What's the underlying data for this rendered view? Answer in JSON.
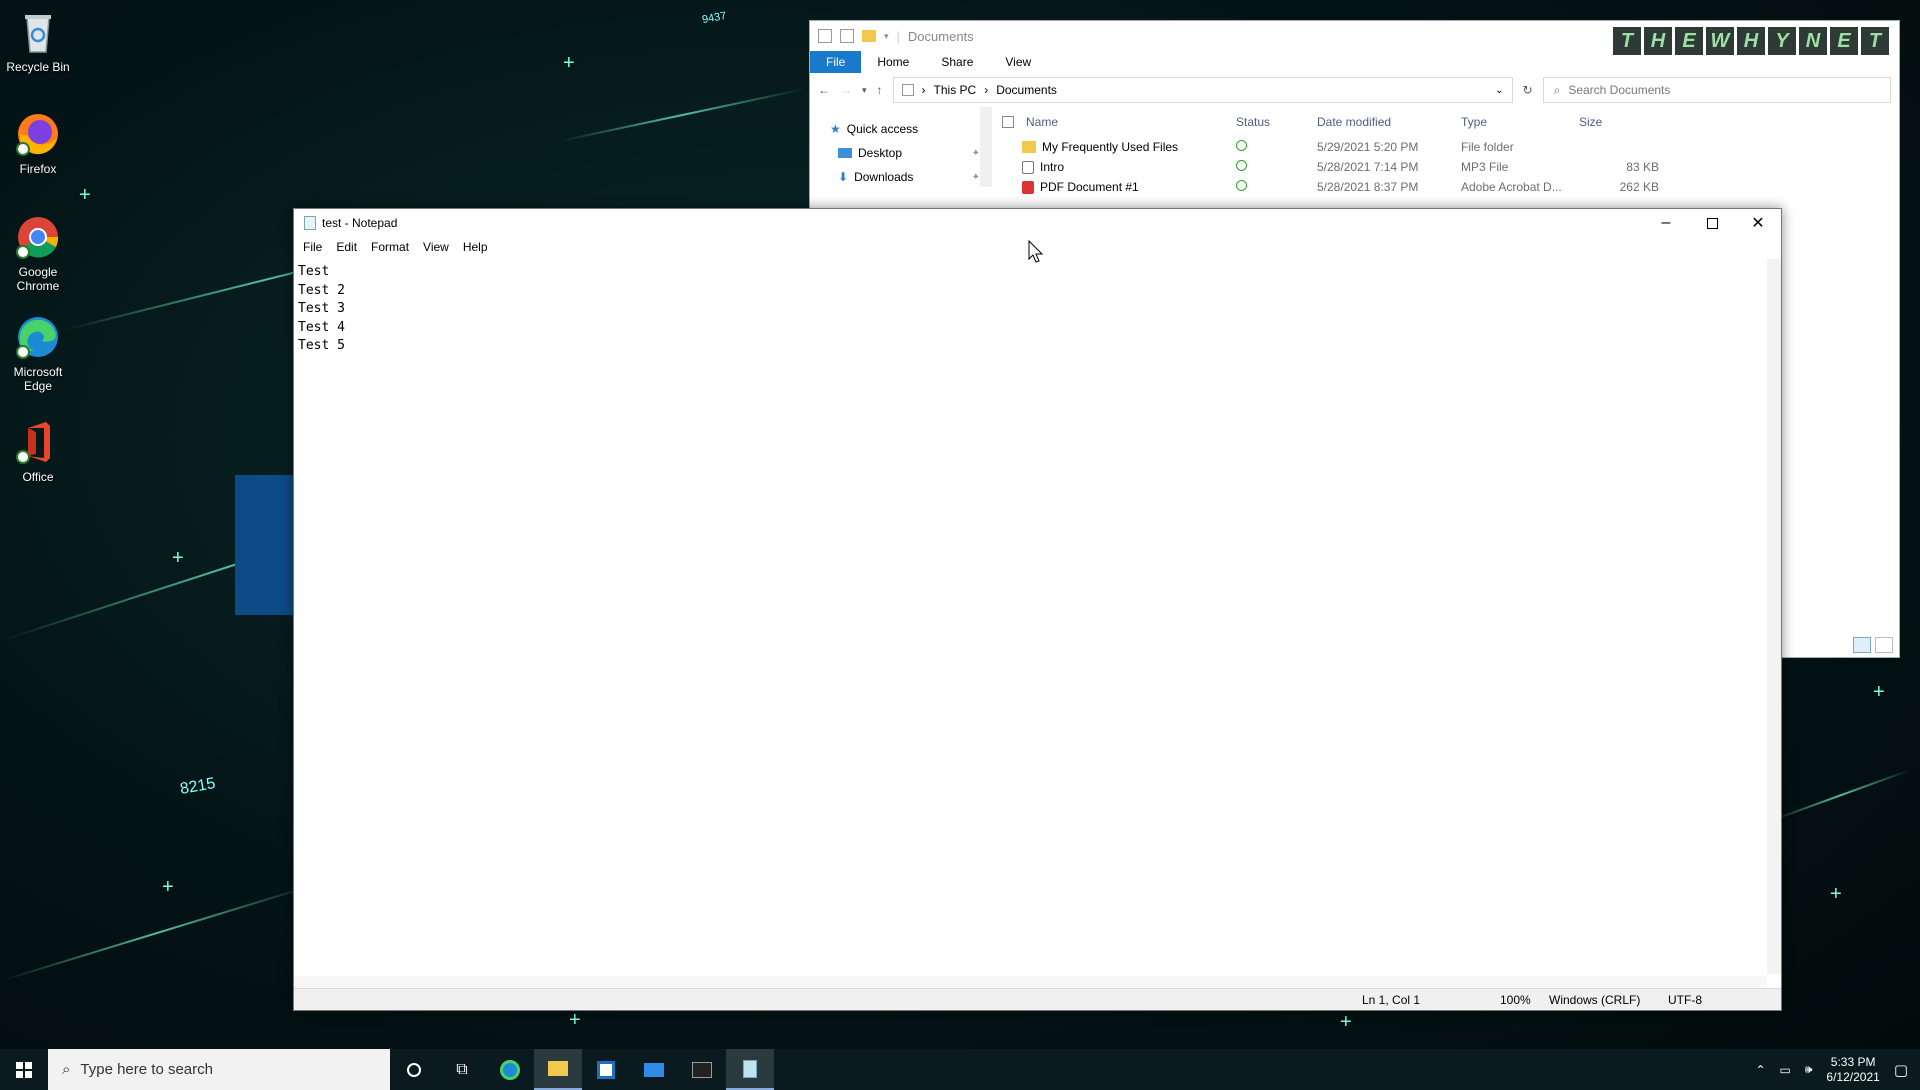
{
  "desktop": {
    "icons": [
      {
        "label": "Recycle Bin"
      },
      {
        "label": "Firefox"
      },
      {
        "label": "Google Chrome"
      },
      {
        "label": "Microsoft Edge"
      },
      {
        "label": "Office"
      }
    ],
    "deco_numbers": [
      "9437",
      "8215"
    ]
  },
  "explorer": {
    "title": "Documents",
    "ribbon": {
      "file": "File",
      "home": "Home",
      "share": "Share",
      "view": "View"
    },
    "breadcrumb": {
      "root": "This PC",
      "current": "Documents"
    },
    "search_placeholder": "Search Documents",
    "nav": {
      "quick_access": "Quick access",
      "desktop": "Desktop",
      "downloads": "Downloads"
    },
    "columns": {
      "name": "Name",
      "status": "Status",
      "date": "Date modified",
      "type": "Type",
      "size": "Size"
    },
    "files": [
      {
        "name": "My Frequently Used Files",
        "date": "5/29/2021 5:20 PM",
        "type": "File folder",
        "size": ""
      },
      {
        "name": "Intro",
        "date": "5/28/2021 7:14 PM",
        "type": "MP3 File",
        "size": "83 KB"
      },
      {
        "name": "PDF Document #1",
        "date": "5/28/2021 8:37 PM",
        "type": "Adobe Acrobat D...",
        "size": "262 KB"
      }
    ],
    "brand_letters": [
      "T",
      "H",
      "E",
      "W",
      "H",
      "Y",
      "N",
      "E",
      "T"
    ]
  },
  "notepad": {
    "title": "test - Notepad",
    "menu": {
      "file": "File",
      "edit": "Edit",
      "format": "Format",
      "view": "View",
      "help": "Help"
    },
    "content": "Test\nTest 2\nTest 3\nTest 4\nTest 5",
    "status": {
      "position": "Ln 1, Col 1",
      "zoom": "100%",
      "line_ending": "Windows (CRLF)",
      "encoding": "UTF-8"
    }
  },
  "taskbar": {
    "search_placeholder": "Type here to search",
    "time": "5:33 PM",
    "date": "6/12/2021"
  }
}
